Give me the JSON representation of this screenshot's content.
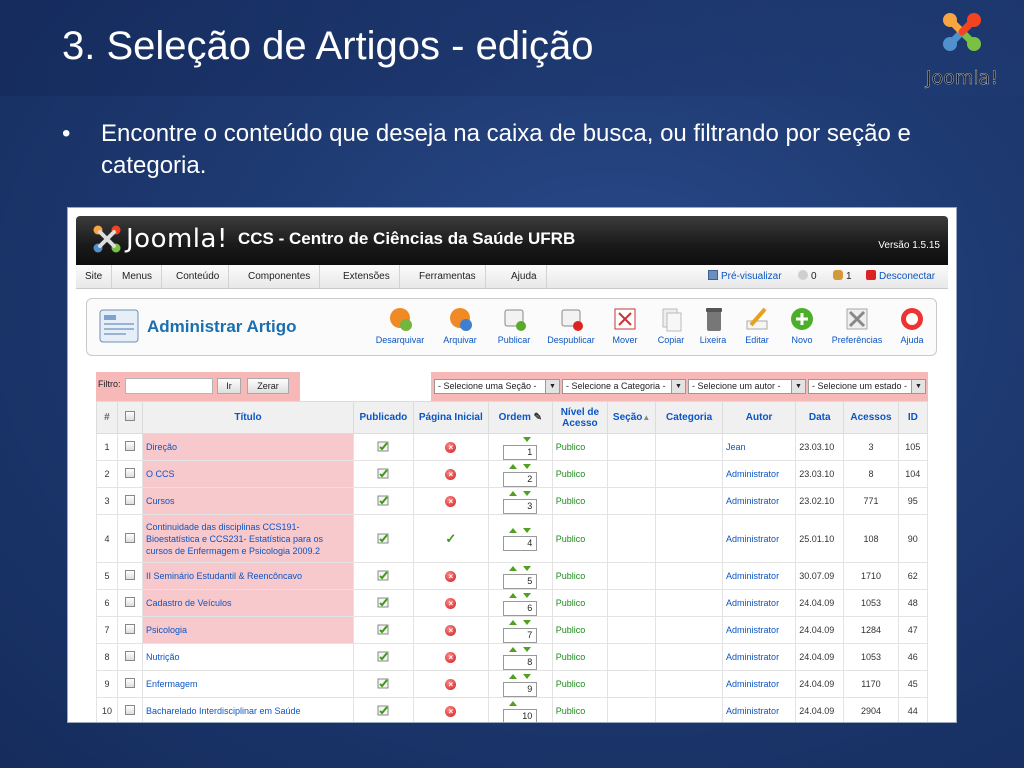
{
  "slide": {
    "title": "3. Seleção de Artigos - edição",
    "bullet": "Encontre o conteúdo que deseja na caixa de busca, ou filtrando por seção e categoria."
  },
  "brand_logo_text": "Joomla!",
  "admin": {
    "logo_text": "Joomla!",
    "site_title": "CCS - Centro de Ciências da Saúde UFRB",
    "version": "Versão 1.5.15",
    "menu": [
      "Site",
      "Menus",
      "Conteúdo",
      "Componentes",
      "Extensões",
      "Ferramentas",
      "Ajuda"
    ],
    "status": {
      "preview": "Pré-visualizar",
      "messages": "0",
      "users": "1",
      "logout": "Desconectar"
    },
    "page_heading": "Administrar Artigo",
    "toolbar": [
      {
        "label": "Desarquivar",
        "icon": "unarchive-icon"
      },
      {
        "label": "Arquivar",
        "icon": "archive-icon"
      },
      {
        "label": "Publicar",
        "icon": "publish-icon"
      },
      {
        "label": "Despublicar",
        "icon": "unpublish-icon"
      },
      {
        "label": "Mover",
        "icon": "move-icon"
      },
      {
        "label": "Copiar",
        "icon": "copy-icon"
      },
      {
        "label": "Lixeira",
        "icon": "trash-icon"
      },
      {
        "label": "Editar",
        "icon": "edit-icon"
      },
      {
        "label": "Novo",
        "icon": "new-icon"
      },
      {
        "label": "Preferências",
        "icon": "preferences-icon"
      },
      {
        "label": "Ajuda",
        "icon": "help-icon"
      }
    ],
    "filter": {
      "label": "Filtro:",
      "value": "",
      "go_label": "Ir",
      "reset_label": "Zerar",
      "selects": [
        "- Selecione uma Seção -",
        "- Selecione a Categoria -",
        "- Selecione um autor -",
        "- Selecione um estado -"
      ]
    },
    "columns": [
      "#",
      "",
      "Título",
      "Publicado",
      "Página Inicial",
      "Ordem",
      "Nível de Acesso",
      "Seção",
      "Categoria",
      "Autor",
      "Data",
      "Acessos",
      "ID"
    ],
    "rows": [
      {
        "num": "1",
        "title": "Direção",
        "published": true,
        "front": false,
        "up": false,
        "down": true,
        "order": "1",
        "access": "Publico",
        "section": "",
        "category": "",
        "author": "Jean",
        "date": "23.03.10",
        "hits": "3",
        "id": "105",
        "highlight": true
      },
      {
        "num": "2",
        "title": "O CCS",
        "published": true,
        "front": false,
        "up": true,
        "down": true,
        "order": "2",
        "access": "Publico",
        "section": "",
        "category": "",
        "author": "Administrator",
        "date": "23.03.10",
        "hits": "8",
        "id": "104",
        "highlight": true
      },
      {
        "num": "3",
        "title": "Cursos",
        "published": true,
        "front": false,
        "up": true,
        "down": true,
        "order": "3",
        "access": "Publico",
        "section": "",
        "category": "",
        "author": "Administrator",
        "date": "23.02.10",
        "hits": "771",
        "id": "95",
        "highlight": true
      },
      {
        "num": "4",
        "title": "Continuidade das disciplinas CCS191- Bioestatística e CCS231- Estatística para os cursos de Enfermagem e Psicologia 2009.2",
        "published": true,
        "front": true,
        "up": true,
        "down": true,
        "order": "4",
        "access": "Publico",
        "section": "",
        "category": "",
        "author": "Administrator",
        "date": "25.01.10",
        "hits": "108",
        "id": "90",
        "highlight": true,
        "tall": true
      },
      {
        "num": "5",
        "title": "II Seminário Estudantil & Reencôncavo",
        "published": true,
        "front": false,
        "up": true,
        "down": true,
        "order": "5",
        "access": "Publico",
        "section": "",
        "category": "",
        "author": "Administrator",
        "date": "30.07.09",
        "hits": "1710",
        "id": "62",
        "highlight": true
      },
      {
        "num": "6",
        "title": "Cadastro de Veículos",
        "published": true,
        "front": false,
        "up": true,
        "down": true,
        "order": "6",
        "access": "Publico",
        "section": "",
        "category": "",
        "author": "Administrator",
        "date": "24.04.09",
        "hits": "1053",
        "id": "48",
        "highlight": true
      },
      {
        "num": "7",
        "title": "Psicologia",
        "published": true,
        "front": false,
        "up": true,
        "down": true,
        "order": "7",
        "access": "Publico",
        "section": "",
        "category": "",
        "author": "Administrator",
        "date": "24.04.09",
        "hits": "1284",
        "id": "47",
        "highlight": true
      },
      {
        "num": "8",
        "title": "Nutrição",
        "published": true,
        "front": false,
        "up": true,
        "down": true,
        "order": "8",
        "access": "Publico",
        "section": "",
        "category": "",
        "author": "Administrator",
        "date": "24.04.09",
        "hits": "1053",
        "id": "46",
        "highlight": false
      },
      {
        "num": "9",
        "title": "Enfermagem",
        "published": true,
        "front": false,
        "up": true,
        "down": true,
        "order": "9",
        "access": "Publico",
        "section": "",
        "category": "",
        "author": "Administrator",
        "date": "24.04.09",
        "hits": "1170",
        "id": "45",
        "highlight": false
      },
      {
        "num": "10",
        "title": "Bacharelado Interdisciplinar em Saúde",
        "published": true,
        "front": false,
        "up": true,
        "down": false,
        "order": "10",
        "access": "Publico",
        "section": "",
        "category": "",
        "author": "Administrator",
        "date": "24.04.09",
        "hits": "2904",
        "id": "44",
        "highlight": false
      }
    ]
  },
  "colors": {
    "background": "#1e3a72",
    "accent_green": "#7dbb2f",
    "link_blue": "#0b55c4",
    "highlight_pink": "#f7b8b8"
  }
}
